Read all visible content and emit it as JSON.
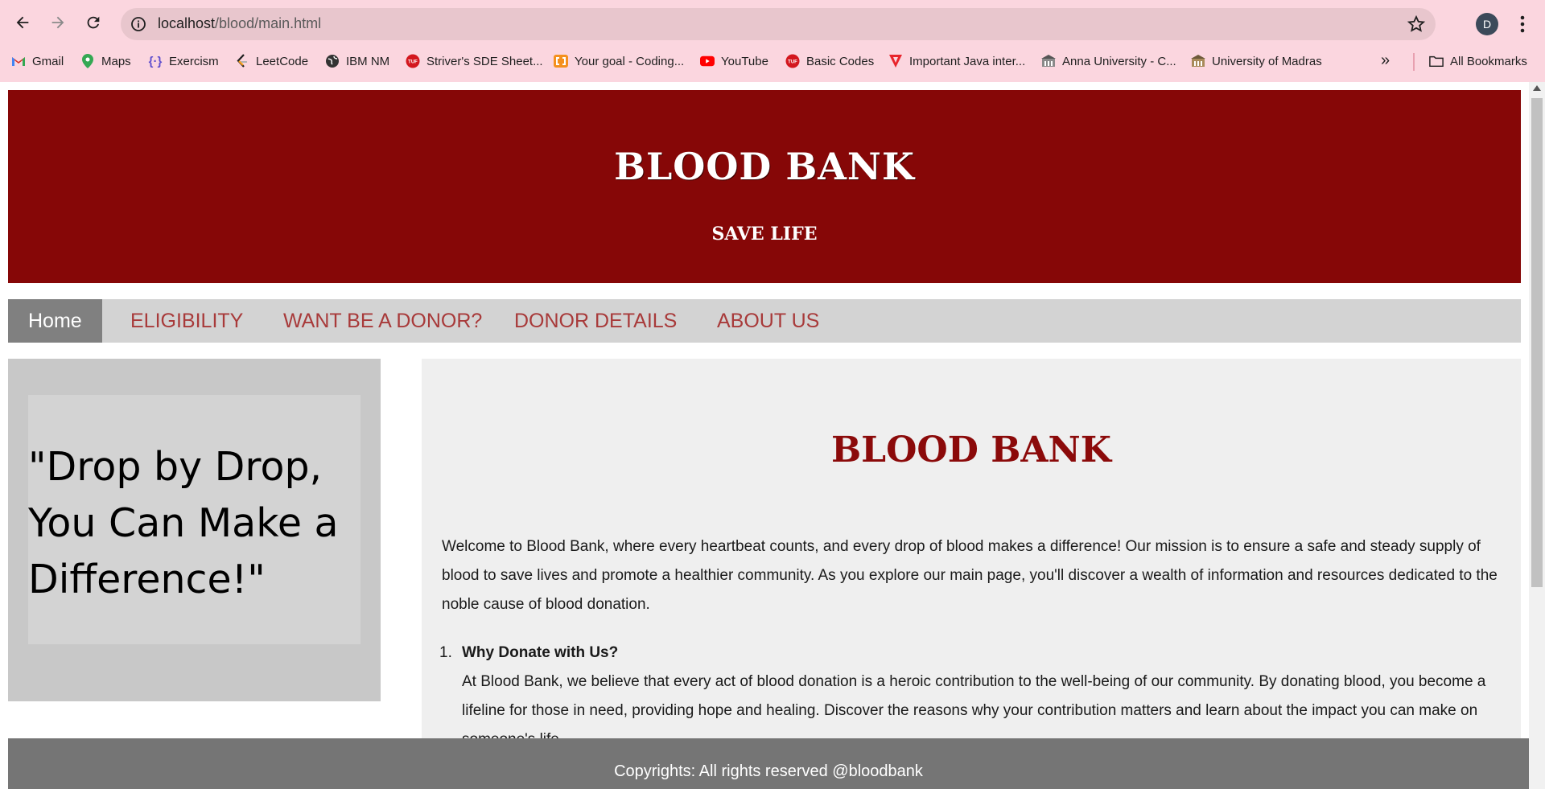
{
  "browser": {
    "url_host": "localhost",
    "url_path": "/blood/main.html",
    "profile_initial": "D",
    "bookmarks": [
      {
        "label": "Gmail",
        "icon": "gmail-icon"
      },
      {
        "label": "Maps",
        "icon": "maps-icon"
      },
      {
        "label": "Exercism",
        "icon": "exercism-icon"
      },
      {
        "label": "LeetCode",
        "icon": "leetcode-icon"
      },
      {
        "label": "IBM NM",
        "icon": "globe-icon"
      },
      {
        "label": "Striver's SDE Sheet...",
        "icon": "tuf-icon"
      },
      {
        "label": "Your goal - Coding...",
        "icon": "coding-icon"
      },
      {
        "label": "YouTube",
        "icon": "youtube-icon"
      },
      {
        "label": "Basic Codes",
        "icon": "tuf-icon"
      },
      {
        "label": "Important Java inter...",
        "icon": "java-icon"
      },
      {
        "label": "Anna University - C...",
        "icon": "university-icon"
      },
      {
        "label": "University of Madras",
        "icon": "university-icon"
      }
    ],
    "all_bookmarks_label": "All Bookmarks"
  },
  "header": {
    "title": "BLOOD BANK",
    "subtitle": "SAVE LIFE"
  },
  "nav": {
    "items": [
      "Home",
      "ELIGIBILITY",
      "WANT BE A DONOR?",
      "DONOR DETAILS",
      "ABOUT US"
    ]
  },
  "sidebar": {
    "quote_line1": "\"Drop by Drop,",
    "quote_line2": "You Can Make a",
    "quote_line3": "Difference!\""
  },
  "main": {
    "heading": "BLOOD BANK",
    "intro": "Welcome to Blood Bank, where every heartbeat counts, and every drop of blood makes a difference! Our mission is to ensure a safe and steady supply of blood to save lives and promote a healthier community. As you explore our main page, you'll discover a wealth of information and resources dedicated to the noble cause of blood donation.",
    "list": [
      {
        "number": "1.",
        "heading": "Why Donate with Us?",
        "text": "At Blood Bank, we believe that every act of blood donation is a heroic contribution to the well-being of our community. By donating blood, you become a lifeline for those in need, providing hope and healing. Discover the reasons why your contribution matters and learn about the impact you can make on someone's life."
      }
    ]
  },
  "footer": {
    "text": "Copyrights: All rights reserved @bloodbank"
  },
  "colors": {
    "header_bg": "#860707",
    "nav_text": "#a83a3a",
    "heading_red": "#8b0a0a",
    "chrome_bg": "#fbd6df"
  }
}
